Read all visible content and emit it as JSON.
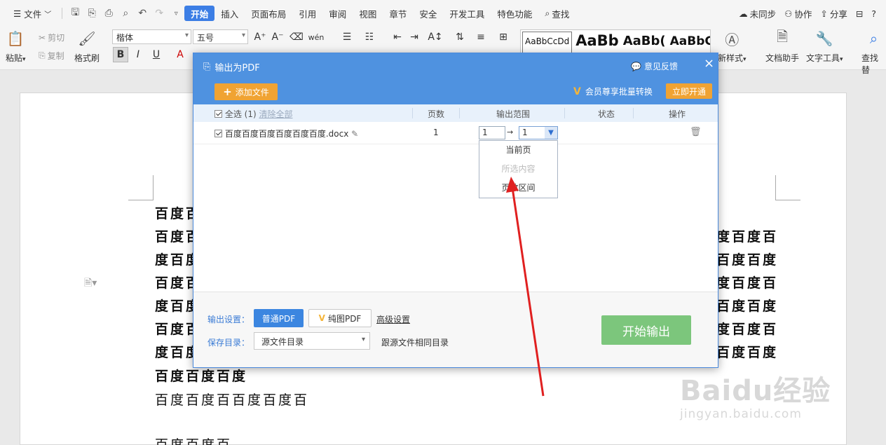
{
  "menubar": {
    "file": "文件",
    "tabs": [
      "开始",
      "插入",
      "页面布局",
      "引用",
      "审阅",
      "视图",
      "章节",
      "安全",
      "开发工具",
      "特色功能"
    ],
    "search": "查找",
    "sync": "未同步",
    "collab": "协作",
    "share": "分享",
    "help": "?"
  },
  "ribbon": {
    "paste": "粘贴",
    "cut": "剪切",
    "copy": "复制",
    "format_painter": "格式刷",
    "font_name": "楷体",
    "font_size": "五号",
    "styles": [
      "AaBbCcDd",
      "AaBb",
      "AaBb(",
      "AaBbC("
    ],
    "new_style": "新样式",
    "doc_assistant": "文档助手",
    "text_tools": "文字工具",
    "find_replace": "查找替"
  },
  "document": {
    "lines": [
      "百度百",
      "百度百",
      "度百度",
      "百度百",
      "度百度",
      "百度百",
      "度百度",
      "百度百度百度",
      "百度百度百百度百度百",
      "百度百度百"
    ],
    "right_lines": [
      "度百度百",
      "百度百度",
      "度百度百",
      "百度百度",
      "度百度百",
      "百度百度"
    ]
  },
  "watermark": {
    "logo": "Baidu经验",
    "url": "jingyan.baidu.com"
  },
  "dialog": {
    "title": "输出为PDF",
    "feedback": "意见反馈",
    "add_file": "添加文件",
    "vip_text": "会员尊享批量转换",
    "open_now": "立即开通",
    "table": {
      "select_all": "全选 (1)",
      "clear_all": "清除全部",
      "col_pages": "页数",
      "col_range": "输出范围",
      "col_status": "状态",
      "col_action": "操作"
    },
    "file": {
      "name": "百度百度百度百度百度百度.docx",
      "pages": "1",
      "range_from": "1",
      "arrow": "→",
      "range_to": "1"
    },
    "dropdown": [
      "当前页",
      "所选内容",
      "页数区间"
    ],
    "output_settings_label": "输出设置：",
    "btn_normal_pdf": "普通PDF",
    "btn_pure_pdf": "纯图PDF",
    "advanced": "高级设置",
    "save_dir_label": "保存目录：",
    "save_dir_value": "源文件目录",
    "save_dir_note": "跟源文件相同目录",
    "start": "开始输出"
  },
  "colors": {
    "dialog_header": "#4f92e0",
    "accent_orange": "#f0a333",
    "start_button": "#7cc67c",
    "active_tab": "#3c7ee5",
    "annotation_arrow": "#e02020"
  }
}
